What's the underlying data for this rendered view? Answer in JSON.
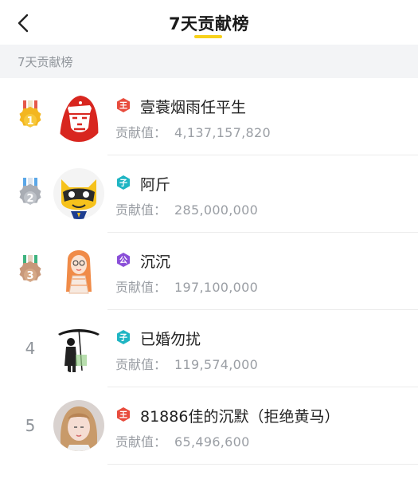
{
  "header": {
    "title": "7天贡献榜",
    "back_icon": "chevron-left-icon"
  },
  "section": {
    "label": "7天贡献榜"
  },
  "colors": {
    "accent": "#f7d11b",
    "gold": "#f3b61f",
    "silver": "#a9adb4",
    "bronze": "#c8987a",
    "badge_red": "#e84c3d",
    "badge_teal": "#1fb5c3",
    "badge_purple": "#8a4fd8"
  },
  "ranking": [
    {
      "rank": "1",
      "medal": "gold-medal-icon",
      "badge": "王",
      "name": "壹蓑烟雨任平生",
      "contrib_label": "贡献值：",
      "contrib_value": "4,137,157,820"
    },
    {
      "rank": "2",
      "medal": "silver-medal-icon",
      "badge": "子",
      "name": "阿斤",
      "contrib_label": "贡献值：",
      "contrib_value": "285,000,000"
    },
    {
      "rank": "3",
      "medal": "bronze-medal-icon",
      "badge": "公",
      "name": "沉沉",
      "contrib_label": "贡献值：",
      "contrib_value": "197,100,000"
    },
    {
      "rank": "4",
      "badge": "子",
      "name": "已婚勿扰",
      "contrib_label": "贡献值：",
      "contrib_value": "119,574,000"
    },
    {
      "rank": "5",
      "badge": "王",
      "name": "81886佳的沉默（拒绝黄马）",
      "contrib_label": "贡献值：",
      "contrib_value": "65,496,600"
    }
  ]
}
